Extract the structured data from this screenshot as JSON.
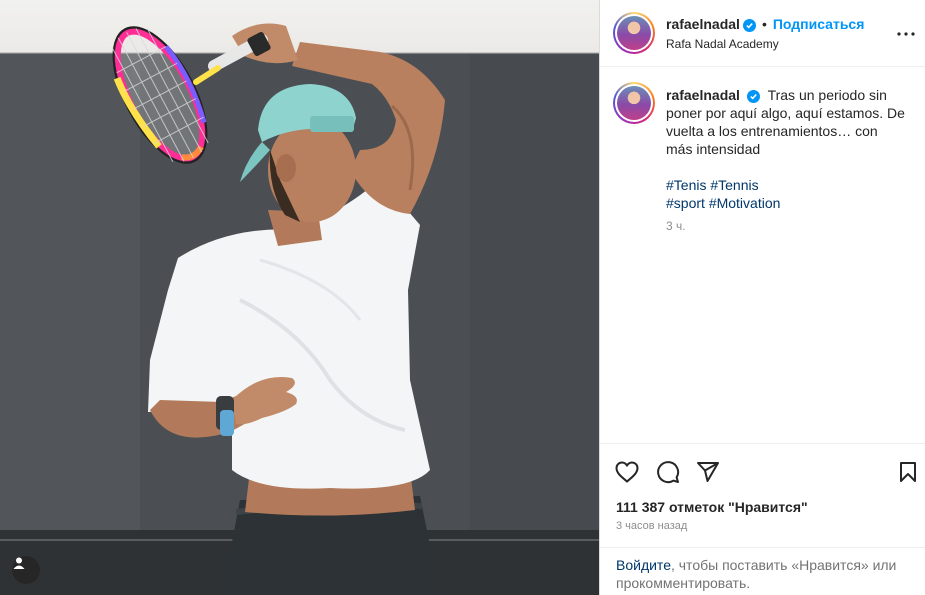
{
  "post": {
    "author": "rafaelnadal",
    "verified": true,
    "follow_label": "Подписаться",
    "separator": "•",
    "location": "Rafa Nadal Academy",
    "caption": "Tras un periodo sin poner por aquí algo, aquí estamos. De vuelta a los entrenamientos… con más intensidad",
    "hashtags": [
      "#Tenis",
      "#Tennis",
      "#sport",
      "#Motivation"
    ],
    "caption_age": "3 ч.",
    "likes_text": "111 387 отметок \"Нравится\"",
    "posted_time": "3 часов назад"
  },
  "login_prompt": {
    "link": "Войдите",
    "text": ", чтобы поставить «Нравится» или прокомментировать."
  },
  "icons": {
    "more": "more-horizontal-icon",
    "like": "heart-icon",
    "comment": "comment-icon",
    "share": "paper-plane-icon",
    "save": "bookmark-icon",
    "user_tags": "user-icon"
  },
  "colors": {
    "accent": "#0095f6",
    "link": "#00376b",
    "muted": "#8e8e8e",
    "text": "#262626"
  }
}
